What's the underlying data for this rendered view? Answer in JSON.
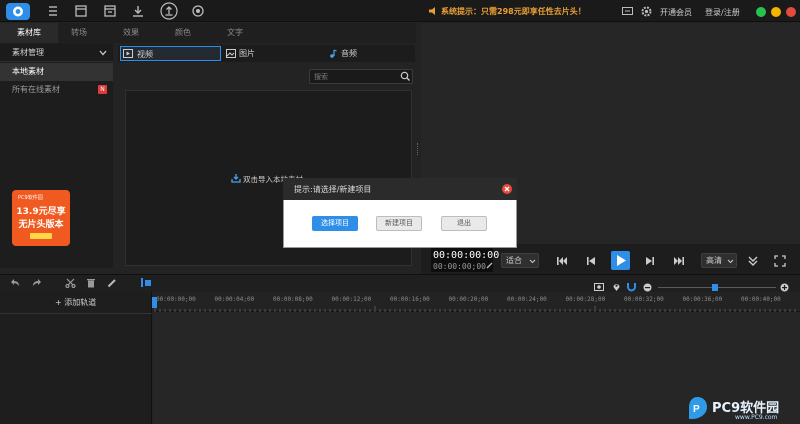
{
  "topbar": {
    "notice": "系统提示：只需298元即享任性去片头！",
    "open_member": "开通会员",
    "login": "登录/注册"
  },
  "tabs": [
    "素材库",
    "转场",
    "效果",
    "颜色",
    "文字"
  ],
  "sidebar": {
    "header": "素材管理",
    "items": [
      "本地素材",
      "所有在线素材"
    ],
    "badge": "N",
    "ad": {
      "line1": "13.9元尽享",
      "line2": "无片头版本",
      "brand": "PC9软件园"
    }
  },
  "media": {
    "tabs": [
      "视频",
      "图片",
      "音频"
    ],
    "search_placeholder": "搜索",
    "import_hint": "双击导入本地素材"
  },
  "preview": {
    "timecode_main": "00:00:00:00",
    "timecode_sub": "00:00:00;00",
    "fit": "适合",
    "quality": "高清"
  },
  "timeline": {
    "add_track": "+ 添加轨道",
    "ticks": [
      "00:00:00;00",
      "00:00:04;00",
      "00:00:08;00",
      "00:00:12;00",
      "00:00:16;00",
      "00:00:20;00",
      "00:00:24;00",
      "00:00:28;00",
      "00:00:32;00",
      "00:00:36;00",
      "00:00:40;00"
    ]
  },
  "dialog": {
    "title": "提示:请选择/新建项目",
    "select": "选择项目",
    "create": "新建项目",
    "exit": "退出"
  },
  "watermark": {
    "text": "PC9软件园",
    "url": "www.PC9.com"
  },
  "colors": {
    "accent_blue": "#1e88e5",
    "notice_orange": "#e8a035",
    "win_green": "#27c24c",
    "win_yellow": "#f5b400",
    "win_red": "#e64a3c"
  }
}
